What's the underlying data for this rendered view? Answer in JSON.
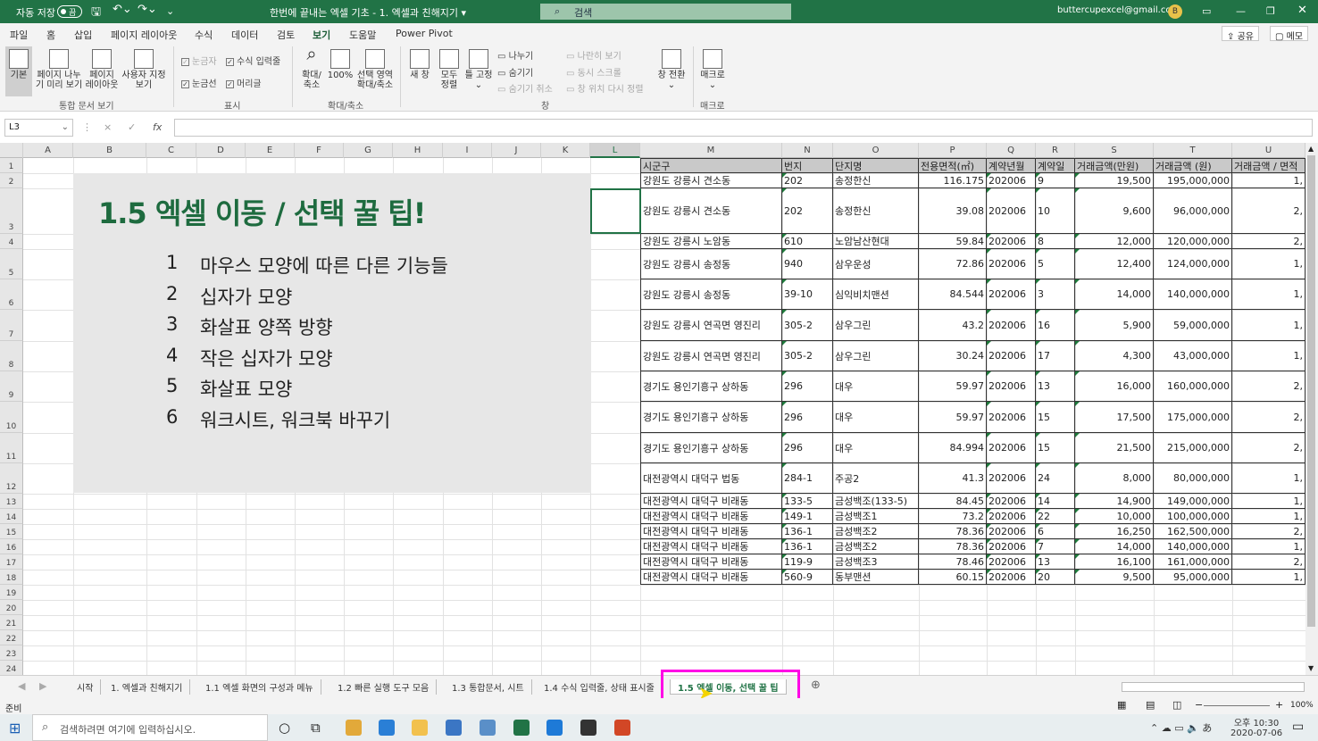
{
  "titlebar": {
    "autosave": "자동 저장",
    "toggle": "끔",
    "title": "한번에 끝내는 엑셀 기초 - 1. 엑셀과 친해지기 ▾",
    "search": "검색",
    "email": "buttercupexcel@gmail.com",
    "avatar": "B"
  },
  "menu": {
    "items": [
      "파일",
      "홈",
      "삽입",
      "페이지 레이아웃",
      "수식",
      "데이터",
      "검토",
      "보기",
      "도움말",
      "Power Pivot"
    ],
    "share": "공유",
    "memo": "메모"
  },
  "ribbon": {
    "views": [
      {
        "label": "기본"
      },
      {
        "label": "페이지 나누\n기 미리 보기"
      },
      {
        "label": "페이지\n레이아웃"
      },
      {
        "label": "사용자 지정\n보기"
      }
    ],
    "views_group": "통합 문서 보기",
    "show": {
      "ruler": "눈금자",
      "formula_bar": "수식 입력줄",
      "gridlines": "눈금선",
      "headings": "머리글"
    },
    "show_group": "표시",
    "zoom": [
      {
        "label": "확대/\n축소"
      },
      {
        "label": "100%"
      },
      {
        "label": "선택 영역\n확대/축소"
      }
    ],
    "zoom_group": "확대/축소",
    "window": [
      {
        "label": "새 창"
      },
      {
        "label": "모두\n정렬"
      },
      {
        "label": "틀 고정\n⌄"
      }
    ],
    "split": "나누기",
    "hide": "숨기기",
    "unhide": "숨기기 취소",
    "side_by_side": "나란히 보기",
    "sync_scroll": "동시 스크롤",
    "reset_pos": "창 위치 다시 정렬",
    "switch": "창 전환\n⌄",
    "window_group": "창",
    "macro": "매크로\n⌄",
    "macro_group": "매크로"
  },
  "formula": {
    "namebox": "L3",
    "fx": "fx",
    "cancel": "×",
    "enter": "✓"
  },
  "columns": [
    "A",
    "B",
    "C",
    "D",
    "E",
    "F",
    "G",
    "H",
    "I",
    "J",
    "K",
    "L",
    "M",
    "N",
    "O",
    "P",
    "Q",
    "R",
    "S",
    "T",
    "U"
  ],
  "rows": [
    "1",
    "2",
    "3",
    "4",
    "5",
    "6",
    "7",
    "8",
    "9",
    "10",
    "11",
    "12",
    "13",
    "14",
    "15",
    "16",
    "17",
    "18",
    "19",
    "20",
    "21",
    "22",
    "23",
    "24"
  ],
  "slide": {
    "title": "1.5 엑셀 이동 / 선택 꿀 팁!",
    "items": [
      {
        "n": "1",
        "t": "마우스 모양에 따른 다른 기능들"
      },
      {
        "n": "2",
        "t": "십자가 모양"
      },
      {
        "n": "3",
        "t": "화살표 양쪽 방향"
      },
      {
        "n": "4",
        "t": "작은 십자가 모양"
      },
      {
        "n": "5",
        "t": "화살표 모양"
      },
      {
        "n": "6",
        "t": "워크시트, 워크북 바꾸기"
      }
    ]
  },
  "table": {
    "headers": [
      "시군구",
      "번지",
      "단지명",
      "전용면적(㎡)",
      "계약년월",
      "계약일",
      "거래금액(만원)",
      "거래금액 (원)",
      "거래금액 / 면적"
    ],
    "rows": [
      [
        "강원도 강릉시 견소동",
        "202",
        "송정한신",
        "116.175",
        "202006",
        "9",
        "19,500",
        "195,000,000",
        "1,"
      ],
      [
        "강원도 강릉시 견소동",
        "202",
        "송정한신",
        "39.08",
        "202006",
        "10",
        "9,600",
        "96,000,000",
        "2,"
      ],
      [
        "강원도 강릉시 노암동",
        "610",
        "노암남산현대",
        "59.84",
        "202006",
        "8",
        "12,000",
        "120,000,000",
        "2,"
      ],
      [
        "강원도 강릉시 송정동",
        "940",
        "삼우운성",
        "72.86",
        "202006",
        "5",
        "12,400",
        "124,000,000",
        "1,"
      ],
      [
        "강원도 강릉시 송정동",
        "39-10",
        "심익비치맨션",
        "84.544",
        "202006",
        "3",
        "14,000",
        "140,000,000",
        "1,"
      ],
      [
        "강원도 강릉시 연곡면 영진리",
        "305-2",
        "삼우그린",
        "43.2",
        "202006",
        "16",
        "5,900",
        "59,000,000",
        "1,"
      ],
      [
        "강원도 강릉시 연곡면 영진리",
        "305-2",
        "삼우그린",
        "30.24",
        "202006",
        "17",
        "4,300",
        "43,000,000",
        "1,"
      ],
      [
        "경기도 용인기흥구 상하동",
        "296",
        "대우",
        "59.97",
        "202006",
        "13",
        "16,000",
        "160,000,000",
        "2,"
      ],
      [
        "경기도 용인기흥구 상하동",
        "296",
        "대우",
        "59.97",
        "202006",
        "15",
        "17,500",
        "175,000,000",
        "2,"
      ],
      [
        "경기도 용인기흥구 상하동",
        "296",
        "대우",
        "84.994",
        "202006",
        "15",
        "21,500",
        "215,000,000",
        "2,"
      ],
      [
        "대전광역시 대덕구 법동",
        "284-1",
        "주공2",
        "41.3",
        "202006",
        "24",
        "8,000",
        "80,000,000",
        "1,"
      ],
      [
        "대전광역시 대덕구 비래동",
        "133-5",
        "금성백조(133-5)",
        "84.45",
        "202006",
        "14",
        "14,900",
        "149,000,000",
        "1,"
      ],
      [
        "대전광역시 대덕구 비래동",
        "149-1",
        "금성백조1",
        "73.2",
        "202006",
        "22",
        "10,000",
        "100,000,000",
        "1,"
      ],
      [
        "대전광역시 대덕구 비래동",
        "136-1",
        "금성백조2",
        "78.36",
        "202006",
        "6",
        "16,250",
        "162,500,000",
        "2,"
      ],
      [
        "대전광역시 대덕구 비래동",
        "136-1",
        "금성백조2",
        "78.36",
        "202006",
        "7",
        "14,000",
        "140,000,000",
        "1,"
      ],
      [
        "대전광역시 대덕구 비래동",
        "119-9",
        "금성백조3",
        "78.46",
        "202006",
        "13",
        "16,100",
        "161,000,000",
        "2,"
      ],
      [
        "대전광역시 대덕구 비래동",
        "560-9",
        "동부맨션",
        "60.15",
        "202006",
        "20",
        "9,500",
        "95,000,000",
        "1,"
      ]
    ]
  },
  "sheets": [
    "시작",
    "1. 엑셀과 친해지기",
    "1.1 엑셀 화면의 구성과 메뉴",
    "1.2 빠른 실행 도구 모음",
    "1.3 통합문서, 시트",
    "1.4 수식 입력줄, 상태 표시줄",
    "1.5 엑셀 이동, 선택 꿀 팁"
  ],
  "status": {
    "ready": "준비",
    "zoom": "100%"
  },
  "taskbar": {
    "search": "검색하려면 여기에 입력하십시오.",
    "time": "오후 10:30",
    "date": "2020-07-06"
  },
  "colors": {
    "excel_green": "#217346",
    "title_green": "#1e6b3f",
    "highlight": "#ff00e6"
  }
}
